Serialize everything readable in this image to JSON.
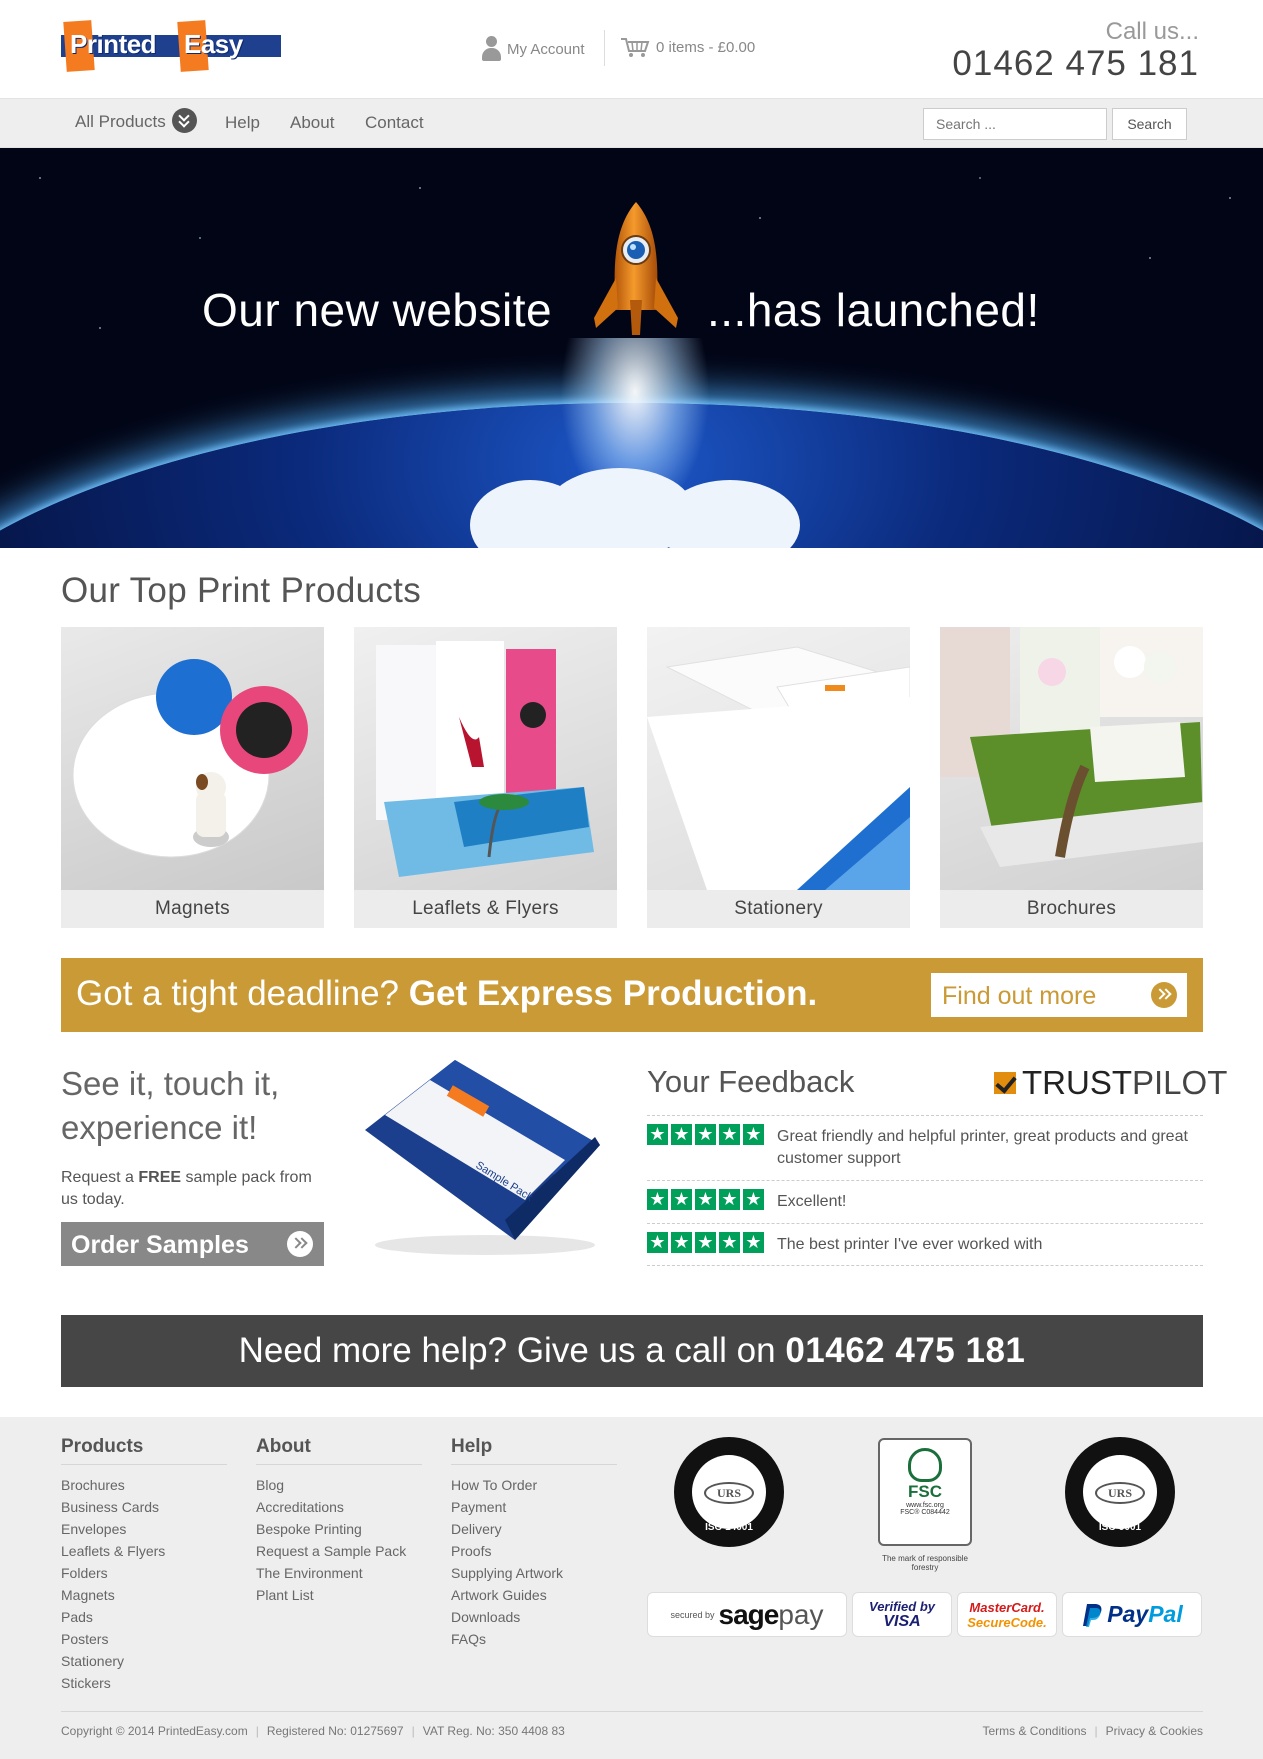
{
  "header": {
    "logo": {
      "part1": "Printed",
      "part2": "Easy"
    },
    "account_label": "My Account",
    "cart_label": "0 items - £0.00",
    "call_label": "Call us...",
    "call_number": "01462 475 181"
  },
  "nav": {
    "items": [
      "All Products",
      "Help",
      "About",
      "Contact"
    ],
    "search_placeholder": "Search ...",
    "search_button": "Search"
  },
  "hero": {
    "left_text": "Our new website",
    "right_text": "...has launched!"
  },
  "products": {
    "title": "Our Top Print Products",
    "items": [
      "Magnets",
      "Leaflets & Flyers",
      "Stationery",
      "Brochures"
    ]
  },
  "express": {
    "lead": "Got a tight deadline?",
    "bold": "Get Express Production.",
    "button": "Find out more"
  },
  "samples": {
    "title_line1": "See it, touch it,",
    "title_line2": "experience it!",
    "text_before": "Request a ",
    "text_bold": "FREE",
    "text_after": " sample pack from us today.",
    "button": "Order Samples",
    "pack_label": "Sample Pack"
  },
  "feedback": {
    "title": "Your Feedback",
    "trustpilot_a": "TRUST",
    "trustpilot_b": "PILOT",
    "reviews": [
      {
        "text": "Great friendly and helpful printer, great products and great customer support",
        "stars": 5
      },
      {
        "text": "Excellent!",
        "stars": 5
      },
      {
        "text": "The best printer I've ever worked with",
        "stars": 5
      }
    ]
  },
  "help_banner": {
    "text": "Need more help? Give us a call on",
    "number": "01462 475 181"
  },
  "footer": {
    "products": {
      "title": "Products",
      "links": [
        "Brochures",
        "Business Cards",
        "Envelopes",
        "Leaflets & Flyers",
        "Folders",
        "Magnets",
        "Pads",
        "Posters",
        "Stationery",
        "Stickers"
      ]
    },
    "about": {
      "title": "About",
      "links": [
        "Blog",
        "Accreditations",
        "Bespoke Printing",
        "Request a Sample Pack",
        "The Environment",
        "Plant List"
      ]
    },
    "help": {
      "title": "Help",
      "links": [
        "How To Order",
        "Payment",
        "Delivery",
        "Proofs",
        "Supplying Artwork",
        "Artwork Guides",
        "Downloads",
        "FAQs"
      ]
    },
    "badges": {
      "iso14001": "ISO 14001",
      "iso9001": "ISO 9001",
      "urs": "URS",
      "fsc": "FSC",
      "fsc_url": "www.fsc.org",
      "fsc_code": "FSC® C084442",
      "fsc_caption": "The mark of responsible forestry"
    },
    "payments": {
      "sagepay_prefix": "secured by",
      "sagepay_a": "sage",
      "sagepay_b": "pay",
      "visa_line1": "Verified by",
      "visa_line2": "VISA",
      "mc_line1": "MasterCard.",
      "mc_line2": "SecureCode.",
      "paypal_a": "Pay",
      "paypal_b": "Pal"
    },
    "copyright": "Copyright © 2014 PrintedEasy.com",
    "registered": "Registered No: 01275697",
    "vat": "VAT Reg. No: 350 4408 83",
    "terms": "Terms & Conditions",
    "privacy": "Privacy & Cookies"
  },
  "colors": {
    "accent_orange": "#f47b20",
    "logo_blue": "#1f3f8f",
    "express_gold": "#c99a35",
    "trustpilot_green": "#00a05a",
    "dark_banner": "#464646"
  }
}
